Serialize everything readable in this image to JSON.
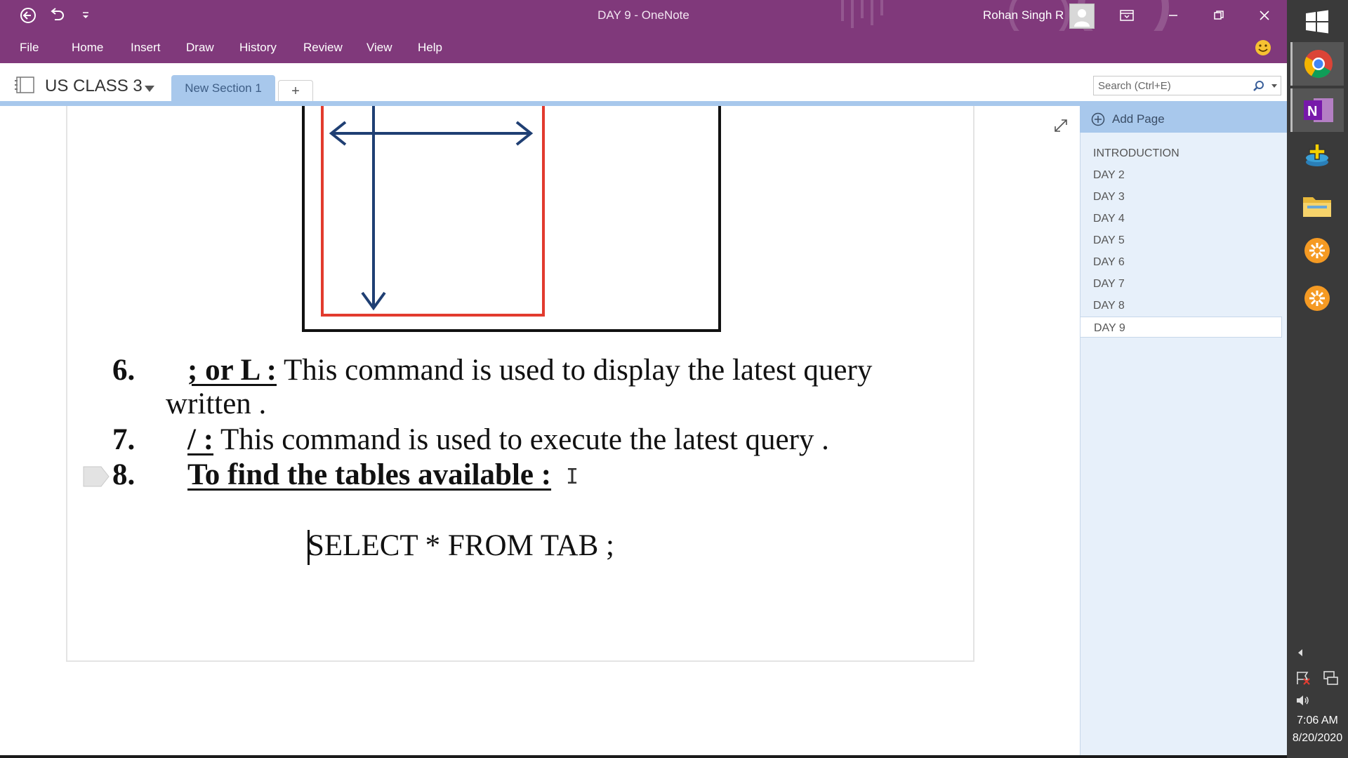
{
  "window": {
    "title": "DAY 9  -  OneNote",
    "user_name": "Rohan Singh R"
  },
  "ribbon": {
    "tabs": [
      "File",
      "Home",
      "Insert",
      "Draw",
      "History",
      "Review",
      "View",
      "Help"
    ]
  },
  "notebook": {
    "name": "US CLASS 3",
    "section_tab": "New Section 1",
    "add_tab_symbol": "+"
  },
  "search": {
    "placeholder": "Search (Ctrl+E)"
  },
  "content": {
    "items": [
      {
        "number": "6.",
        "command": "; or L :",
        "text": " This command is used to display the latest query",
        "continuation": "written ."
      },
      {
        "number": "7.",
        "command": "/ :",
        "text": " This command is used to execute the latest query ."
      },
      {
        "number": "8.",
        "command": "To find the tables available  :",
        "text": ""
      }
    ],
    "sql": "SELECT * FROM TAB ;"
  },
  "pages": {
    "add_label": "Add Page",
    "list": [
      "INTRODUCTION",
      "DAY 2",
      "DAY 3",
      "DAY 4",
      "DAY 5",
      "DAY 6",
      "DAY 7",
      "DAY 8",
      "DAY 9"
    ],
    "active": "DAY 9"
  },
  "taskbar": {
    "time": "7:06 AM",
    "date": "8/20/2020"
  },
  "colors": {
    "onenote_purple": "#80397b",
    "section_blue": "#a8c8ec",
    "diagram_red": "#e23b2e",
    "diagram_arrow": "#1f3f73"
  }
}
